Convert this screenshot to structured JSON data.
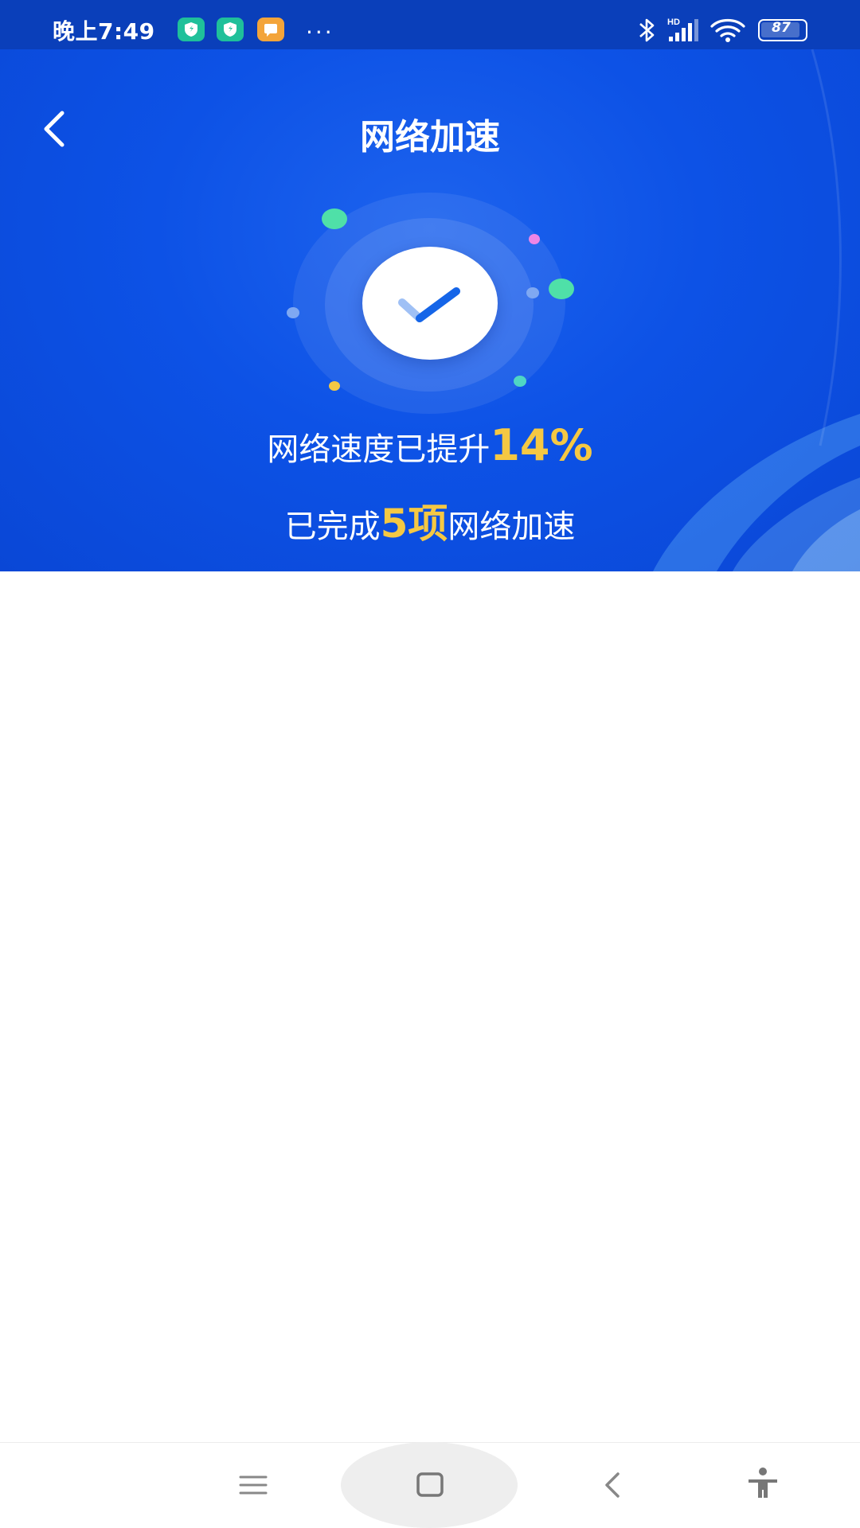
{
  "status_bar": {
    "time": "晚上7:49",
    "notification_icons": [
      "shield-app-icon",
      "shield-app-icon",
      "message-app-icon"
    ],
    "more_indicator": "···",
    "battery_level": "87",
    "icons": [
      "bluetooth-icon",
      "signal-hd-icon",
      "wifi-icon",
      "battery-icon"
    ]
  },
  "header": {
    "title": "网络加速",
    "back_icon": "chevron-left-icon"
  },
  "result": {
    "speed_prefix": "网络速度已提升",
    "speed_value": "14%",
    "done_prefix": "已完成",
    "done_count": "5项",
    "done_suffix": "网络加速",
    "icon": "check-icon"
  },
  "nav_bar": {
    "buttons": [
      "menu-icon",
      "home-icon",
      "back-icon",
      "accessibility-icon"
    ]
  },
  "colors": {
    "hero_blue": "#0d52e6",
    "status_band": "#0a3fba",
    "highlight_yellow": "#f5c843",
    "check_blue": "#1565e8"
  }
}
